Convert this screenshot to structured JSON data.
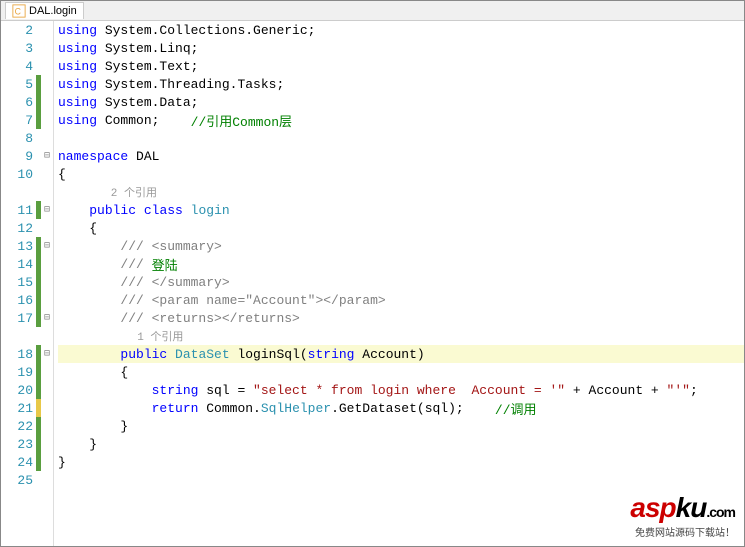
{
  "tab": {
    "title": "DAL.login"
  },
  "refs": {
    "class_ref": "2 个引用",
    "method_ref": "1 个引用"
  },
  "lines": [
    {
      "num": 2,
      "change": "",
      "fold": "",
      "tokens": [
        [
          "kw",
          "using"
        ],
        [
          "ident",
          " System.Collections.Generic;"
        ]
      ]
    },
    {
      "num": 3,
      "change": "",
      "fold": "",
      "tokens": [
        [
          "kw",
          "using"
        ],
        [
          "ident",
          " System.Linq;"
        ]
      ]
    },
    {
      "num": 4,
      "change": "",
      "fold": "",
      "tokens": [
        [
          "kw",
          "using"
        ],
        [
          "ident",
          " System.Text;"
        ]
      ]
    },
    {
      "num": 5,
      "change": "green",
      "fold": "",
      "tokens": [
        [
          "kw",
          "using"
        ],
        [
          "ident",
          " System.Threading.Tasks;"
        ]
      ]
    },
    {
      "num": 6,
      "change": "green",
      "fold": "",
      "tokens": [
        [
          "kw",
          "using"
        ],
        [
          "ident",
          " System.Data;"
        ]
      ]
    },
    {
      "num": 7,
      "change": "green",
      "fold": "",
      "tokens": [
        [
          "kw",
          "using"
        ],
        [
          "ident",
          " Common;    "
        ],
        [
          "comment",
          "//引用Common层"
        ]
      ]
    },
    {
      "num": 8,
      "change": "",
      "fold": "",
      "tokens": []
    },
    {
      "num": 9,
      "change": "",
      "fold": "⊟",
      "tokens": [
        [
          "kw",
          "namespace"
        ],
        [
          "ident",
          " DAL"
        ]
      ]
    },
    {
      "num": 10,
      "change": "",
      "fold": "",
      "tokens": [
        [
          "ident",
          "{"
        ]
      ]
    },
    {
      "ref": "class_ref",
      "indent": "        "
    },
    {
      "num": 11,
      "change": "green",
      "fold": "⊟",
      "tokens": [
        [
          "ident",
          "    "
        ],
        [
          "kw",
          "public"
        ],
        [
          "ident",
          " "
        ],
        [
          "kw",
          "class"
        ],
        [
          "ident",
          " "
        ],
        [
          "type",
          "login"
        ]
      ]
    },
    {
      "num": 12,
      "change": "",
      "fold": "",
      "tokens": [
        [
          "ident",
          "    {"
        ]
      ]
    },
    {
      "num": 13,
      "change": "green",
      "fold": "⊟",
      "tokens": [
        [
          "ident",
          "        "
        ],
        [
          "xml-doc",
          "/// <summary>"
        ]
      ]
    },
    {
      "num": 14,
      "change": "green",
      "fold": "",
      "tokens": [
        [
          "ident",
          "        "
        ],
        [
          "xml-doc",
          "/// "
        ],
        [
          "comment",
          "登陆"
        ]
      ]
    },
    {
      "num": 15,
      "change": "green",
      "fold": "",
      "tokens": [
        [
          "ident",
          "        "
        ],
        [
          "xml-doc",
          "/// </summary>"
        ]
      ]
    },
    {
      "num": 16,
      "change": "green",
      "fold": "",
      "tokens": [
        [
          "ident",
          "        "
        ],
        [
          "xml-doc",
          "/// <param name=\"Account\"></param>"
        ]
      ]
    },
    {
      "num": 17,
      "change": "green",
      "fold": "⊟",
      "tokens": [
        [
          "ident",
          "        "
        ],
        [
          "xml-doc",
          "/// <returns></returns>"
        ]
      ]
    },
    {
      "ref": "method_ref",
      "indent": "            "
    },
    {
      "num": 18,
      "change": "green",
      "fold": "⊟",
      "hl": true,
      "tokens": [
        [
          "ident",
          "        "
        ],
        [
          "kw",
          "public"
        ],
        [
          "ident",
          " "
        ],
        [
          "type",
          "DataSet"
        ],
        [
          "ident",
          " loginSql("
        ],
        [
          "kw",
          "string"
        ],
        [
          "ident",
          " Account)"
        ]
      ]
    },
    {
      "num": 19,
      "change": "green",
      "fold": "",
      "tokens": [
        [
          "ident",
          "        {"
        ]
      ]
    },
    {
      "num": 20,
      "change": "green",
      "fold": "",
      "tokens": [
        [
          "ident",
          "            "
        ],
        [
          "kw",
          "string"
        ],
        [
          "ident",
          " sql = "
        ],
        [
          "str",
          "\"select * from login where  Account = '\""
        ],
        [
          "ident",
          " + Account + "
        ],
        [
          "str",
          "\"'\""
        ],
        [
          "ident",
          ";"
        ]
      ]
    },
    {
      "num": 21,
      "change": "yellow",
      "fold": "",
      "tokens": [
        [
          "ident",
          "            "
        ],
        [
          "kw",
          "return"
        ],
        [
          "ident",
          " Common."
        ],
        [
          "type",
          "SqlHelper"
        ],
        [
          "ident",
          ".GetDataset(sql);    "
        ],
        [
          "comment",
          "//调用"
        ]
      ]
    },
    {
      "num": 22,
      "change": "green",
      "fold": "",
      "tokens": [
        [
          "ident",
          "        }"
        ]
      ]
    },
    {
      "num": 23,
      "change": "green",
      "fold": "",
      "tokens": [
        [
          "ident",
          "    }"
        ]
      ]
    },
    {
      "num": 24,
      "change": "green",
      "fold": "",
      "tokens": [
        [
          "ident",
          "}"
        ]
      ]
    },
    {
      "num": 25,
      "change": "",
      "fold": "",
      "tokens": []
    }
  ],
  "watermark": {
    "brand_red": "asp",
    "brand_black": "ku",
    "brand_dot": ".com",
    "sub": "免费网站源码下载站！"
  }
}
